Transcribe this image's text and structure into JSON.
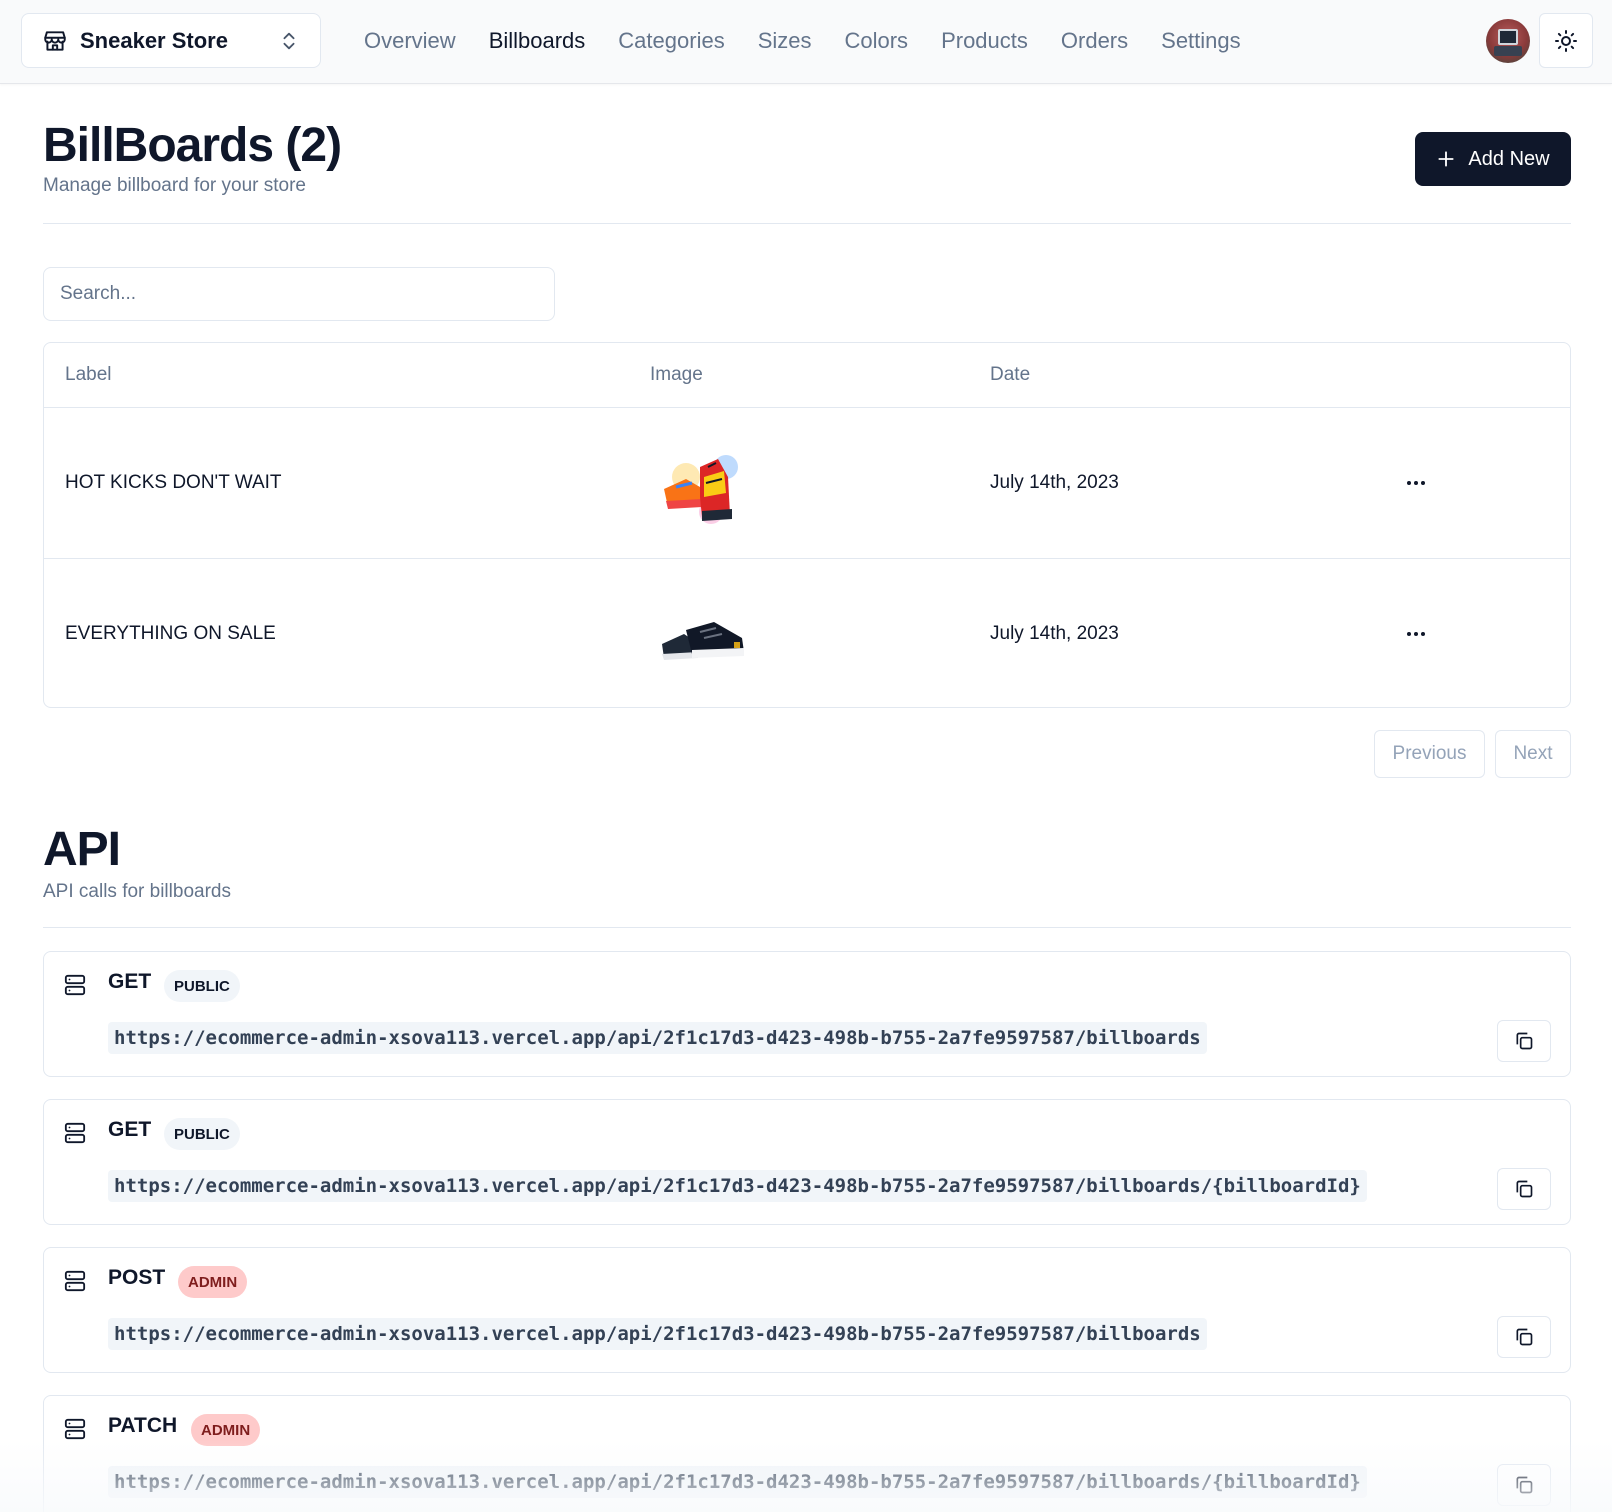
{
  "store_switcher": {
    "name": "Sneaker Store",
    "icon": "store-icon"
  },
  "nav": {
    "items": [
      "Overview",
      "Billboards",
      "Categories",
      "Sizes",
      "Colors",
      "Products",
      "Orders",
      "Settings"
    ],
    "active": "Billboards"
  },
  "header": {
    "title": "BillBoards (2)",
    "subtitle": "Manage billboard for your store",
    "add_label": "Add New"
  },
  "search": {
    "placeholder": "Search..."
  },
  "table": {
    "columns": [
      "Label",
      "Image",
      "Date"
    ],
    "rows": [
      {
        "label": "HOT KICKS DON'T WAIT",
        "image": "colorful-sneakers-art",
        "date": "July 14th, 2023"
      },
      {
        "label": "EVERYTHING ON SALE",
        "image": "black-sneakers",
        "date": "July 14th, 2023"
      }
    ]
  },
  "pagination": {
    "previous": "Previous",
    "next": "Next"
  },
  "api": {
    "title": "API",
    "subtitle": "API calls for billboards",
    "routes": [
      {
        "method": "GET",
        "access": "PUBLIC",
        "url": "https://ecommerce-admin-xsova113.vercel.app/api/2f1c17d3-d423-498b-b755-2a7fe9597587/billboards"
      },
      {
        "method": "GET",
        "access": "PUBLIC",
        "url": "https://ecommerce-admin-xsova113.vercel.app/api/2f1c17d3-d423-498b-b755-2a7fe9597587/billboards/{billboardId}"
      },
      {
        "method": "POST",
        "access": "ADMIN",
        "url": "https://ecommerce-admin-xsova113.vercel.app/api/2f1c17d3-d423-498b-b755-2a7fe9597587/billboards"
      },
      {
        "method": "PATCH",
        "access": "ADMIN",
        "url": "https://ecommerce-admin-xsova113.vercel.app/api/2f1c17d3-d423-498b-b755-2a7fe9597587/billboards/{billboardId}"
      }
    ]
  },
  "colors": {
    "primary": "#0f172a",
    "muted": "#64748b",
    "border": "#e2e8f0",
    "admin_badge": "#fecaca",
    "public_badge": "#f1f5f9"
  }
}
